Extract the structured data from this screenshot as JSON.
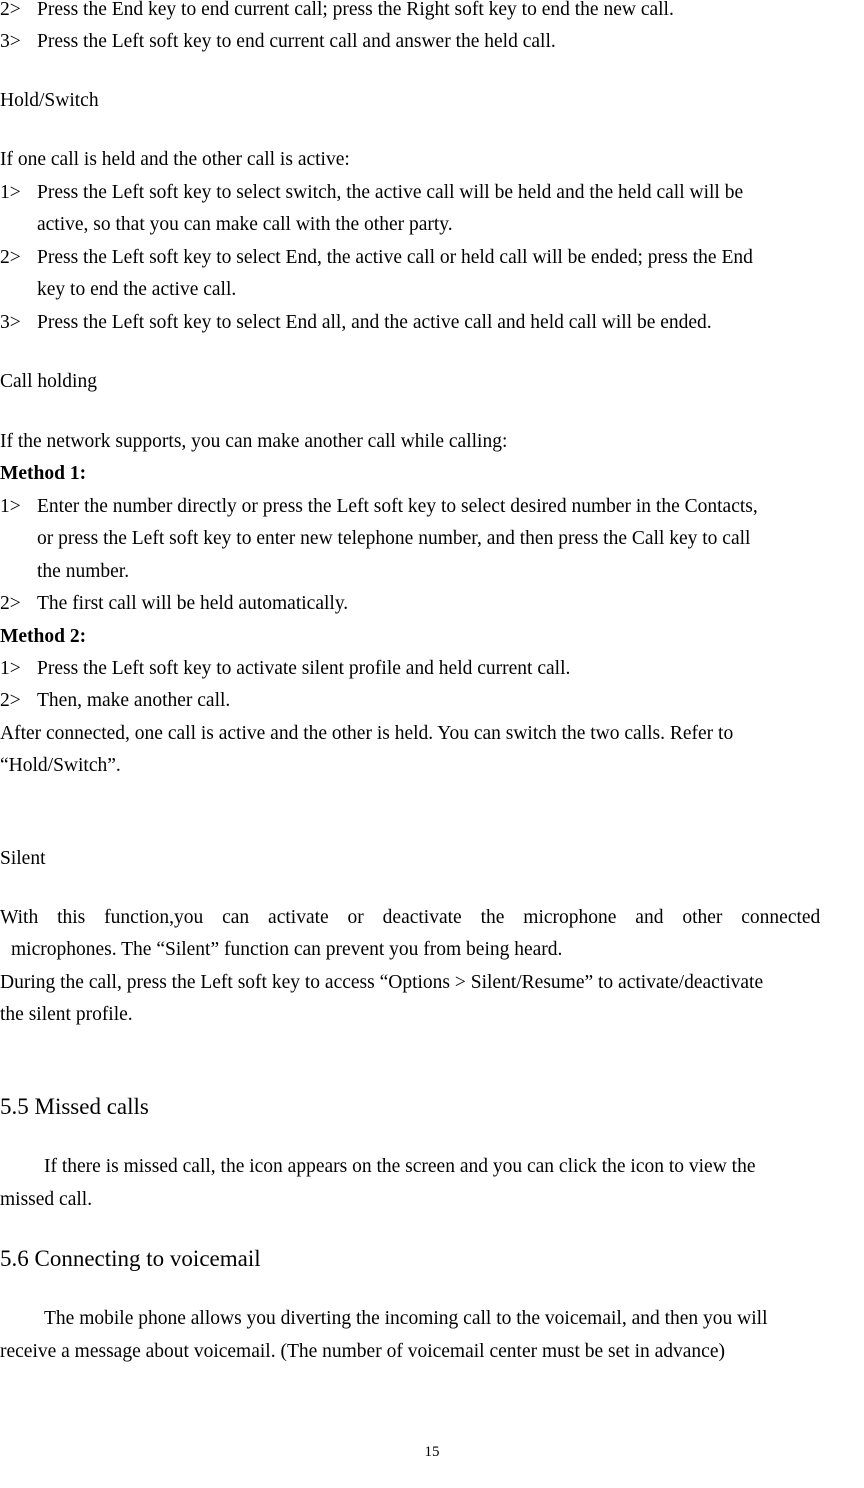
{
  "top_list": [
    {
      "num": "2>",
      "text": "Press the End key to end current call; press the Right soft key to end the new call."
    },
    {
      "num": "3>",
      "text": "Press the Left soft key to end current call and answer the held call."
    }
  ],
  "hold_switch": {
    "heading": "Hold/Switch",
    "intro": "If one call is held and the other call is active:",
    "items": [
      {
        "num": "1>",
        "lines": [
          "Press the Left soft key to select switch, the active call will be held and the held call will be",
          "active, so that you can make call with the other party."
        ]
      },
      {
        "num": "2>",
        "lines": [
          "Press the Left soft key to select End, the active call or held call will be ended; press the End",
          "key to end the active call."
        ]
      },
      {
        "num": "3>",
        "lines": [
          "Press the Left soft key to select End all, and the active call and held call will be ended."
        ]
      }
    ]
  },
  "call_holding": {
    "heading": "Call holding",
    "intro": "If the network supports, you can make another call while calling:",
    "method1": {
      "label": "Method 1:",
      "items": [
        {
          "num": "1>",
          "lines": [
            "Enter the number directly or press the Left soft key to select desired number in the Contacts,",
            "or press the Left soft key to enter new telephone number, and then press the Call key to call",
            "the number."
          ]
        },
        {
          "num": "2>",
          "lines": [
            "The first call will be held automatically."
          ]
        }
      ]
    },
    "method2": {
      "label": "Method 2:",
      "items": [
        {
          "num": "1>",
          "lines": [
            "Press the Left soft key to activate silent profile and held current call."
          ]
        },
        {
          "num": "2>",
          "lines": [
            "Then, make another call."
          ]
        }
      ]
    },
    "after": [
      "After connected, one call is active and the other is held. You can switch the two calls. Refer to",
      "“Hold/Switch”."
    ]
  },
  "silent": {
    "heading": "Silent",
    "para1": [
      "With this function,you can activate or deactivate the microphone and other connected",
      "microphones. The “Silent” function can prevent you from being heard."
    ],
    "para2": [
      "During the call, press the Left soft key to access “Options > Silent/Resume” to activate/deactivate",
      "the silent profile."
    ]
  },
  "missed_calls": {
    "heading": "5.5 Missed calls",
    "para": [
      "If there is missed call, the icon appears on the screen and you can click the icon to view the",
      "missed call."
    ]
  },
  "voicemail": {
    "heading": "5.6 Connecting to voicemail",
    "para": [
      "The mobile phone allows you diverting the incoming call to the voicemail, and then you will",
      "receive a message about voicemail. (The number of voicemail center must be set in advance)"
    ]
  },
  "page_number": "15"
}
